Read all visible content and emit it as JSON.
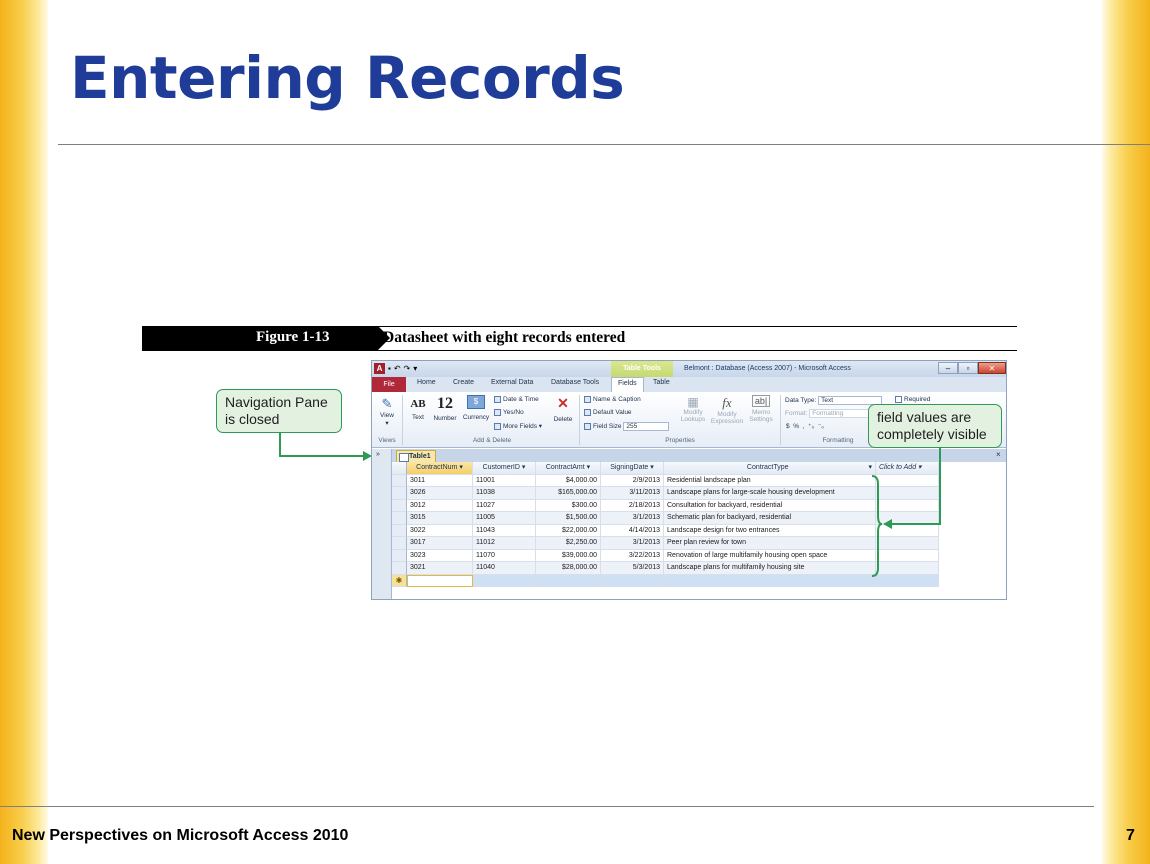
{
  "slide": {
    "title": "Entering Records",
    "footer": "New Perspectives on Microsoft Access 2010",
    "page_number": "7"
  },
  "figure": {
    "label": "Figure 1-13",
    "description": "Datasheet with eight records entered"
  },
  "callouts": {
    "navigation_pane": "Navigation Pane is closed",
    "field_values": "field values are completely visible"
  },
  "window": {
    "title": "Belmont : Database (Access 2007) - Microsoft Access",
    "context_tab_group": "Table Tools",
    "tabs": [
      "File",
      "Home",
      "Create",
      "External Data",
      "Database Tools",
      "Fields",
      "Table"
    ],
    "active_tab": "Fields",
    "ribbon": {
      "view_label": "View",
      "views_group": "Views",
      "text_label": "Text",
      "number_label": "Number",
      "currency_label": "Currency",
      "date_time_label": "Date & Time",
      "yes_no_label": "Yes/No",
      "more_fields_label": "More Fields",
      "delete_label": "Delete",
      "add_delete_group": "Add & Delete",
      "name_caption_label": "Name & Caption",
      "default_value_label": "Default Value",
      "field_size_label": "Field Size",
      "field_size_value": "255",
      "modify_lookups_label": "Modify Lookups",
      "modify_expression_label": "Modify Expression",
      "memo_settings_label": "Memo Settings",
      "properties_group": "Properties",
      "data_type_label": "Data Type:",
      "data_type_value": "Text",
      "format_label": "Format:",
      "format_value": "Formatting",
      "required_label": "Required",
      "formatting_group": "Formatting"
    },
    "document_tab": "Table1"
  },
  "table": {
    "columns": [
      "ContractNum",
      "CustomerID",
      "ContractAmt",
      "SigningDate",
      "ContractType",
      "Click to Add"
    ],
    "rows": [
      [
        "3011",
        "11001",
        "$4,000.00",
        "2/9/2013",
        "Residential landscape plan"
      ],
      [
        "3026",
        "11038",
        "$165,000.00",
        "3/11/2013",
        "Landscape plans for large-scale housing development"
      ],
      [
        "3012",
        "11027",
        "$300.00",
        "2/18/2013",
        "Consultation for backyard, residential"
      ],
      [
        "3015",
        "11005",
        "$1,500.00",
        "3/1/2013",
        "Schematic plan for backyard, residential"
      ],
      [
        "3022",
        "11043",
        "$22,000.00",
        "4/14/2013",
        "Landscape design for two entrances"
      ],
      [
        "3017",
        "11012",
        "$2,250.00",
        "3/1/2013",
        "Peer plan review for town"
      ],
      [
        "3023",
        "11070",
        "$39,000.00",
        "3/22/2013",
        "Renovation of large multifamily housing open space"
      ],
      [
        "3021",
        "11040",
        "$28,000.00",
        "5/3/2013",
        "Landscape plans for multifamily housing site"
      ]
    ],
    "new_row_marker": "✱"
  },
  "colors": {
    "title_blue": "#1f3c98",
    "side_gold": "#f3b21a",
    "callout_green": "#2f9a55",
    "file_tab_red": "#b0293a"
  }
}
